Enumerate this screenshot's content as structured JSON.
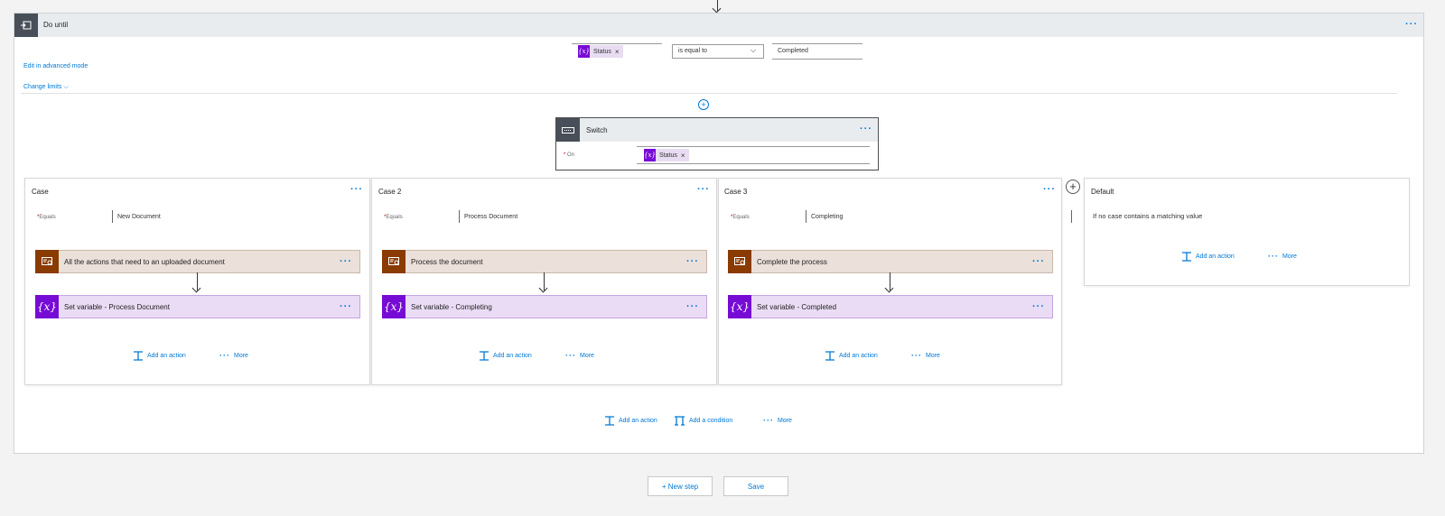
{
  "do_until": {
    "title": "Do until",
    "condition": {
      "token_label": "Status",
      "token_icon": "{x}",
      "operator": "is equal to",
      "value": "Completed"
    },
    "edit_advanced_label": "Edit in advanced mode",
    "change_limits_label": "Change limits"
  },
  "switch": {
    "title": "Switch",
    "on_label": "On",
    "token_label": "Status",
    "token_icon": "{x}"
  },
  "cases": [
    {
      "title": "Case",
      "equals_label": "Equals",
      "equals_value": "New Document",
      "action1": "All the actions that need to an uploaded document",
      "action2": "Set variable - Process Document",
      "add_action": "Add an action",
      "more": "More"
    },
    {
      "title": "Case 2",
      "equals_label": "Equals",
      "equals_value": "Process Document",
      "action1": "Process the document",
      "action2": "Set variable - Completing",
      "add_action": "Add an action",
      "more": "More"
    },
    {
      "title": "Case 3",
      "equals_label": "Equals",
      "equals_value": "Completing",
      "action1": "Complete the process",
      "action2": "Set variable - Completed",
      "add_action": "Add an action",
      "more": "More"
    }
  ],
  "default_case": {
    "title": "Default",
    "message": "If no case contains a matching value",
    "add_action": "Add an action",
    "more": "More"
  },
  "loop_footer": {
    "add_action": "Add an action",
    "add_condition": "Add a condition",
    "more": "More"
  },
  "footer": {
    "new_step": "+ New step",
    "save": "Save"
  },
  "colors": {
    "accent": "#0078d4",
    "variable_purple": "#770bd6",
    "office_brown": "#8a3b00",
    "header_gray": "#e9ecef"
  }
}
